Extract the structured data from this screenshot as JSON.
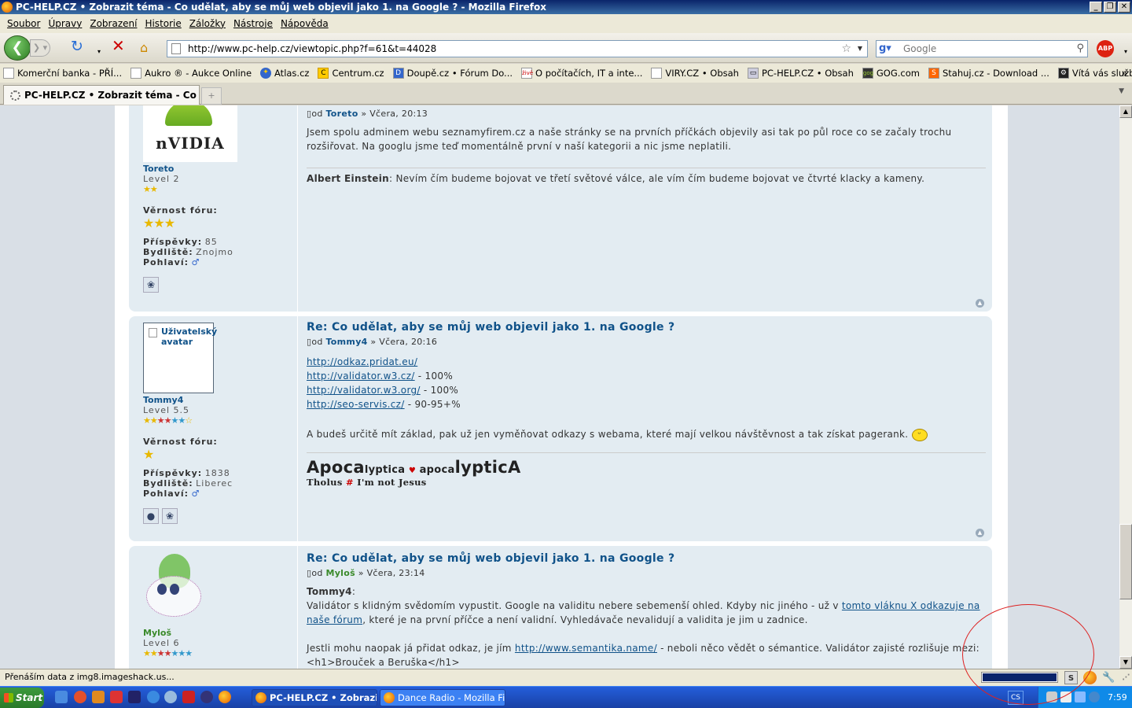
{
  "window": {
    "title": "PC-HELP.CZ • Zobrazit téma - Co udělat, aby se můj web objevil jako 1. na Google ? - Mozilla Firefox",
    "minimize": "0",
    "maximize": "1",
    "close": "r"
  },
  "menu": [
    "Soubor",
    "Úpravy",
    "Zobrazení",
    "Historie",
    "Záložky",
    "Nástroje",
    "Nápověda"
  ],
  "nav": {
    "url": "http://www.pc-help.cz/viewtopic.php?f=61&t=44028",
    "search_placeholder": "Google",
    "adblock_label": "ABP"
  },
  "bookmarks": [
    {
      "label": "Komerční banka - PŘÍ..."
    },
    {
      "label": "Aukro ® - Aukce Online"
    },
    {
      "label": "Atlas.cz"
    },
    {
      "label": "Centrum.cz"
    },
    {
      "label": "Doupě.cz • Fórum Do..."
    },
    {
      "label": "O počítačích, IT a inte..."
    },
    {
      "label": "VIRY.CZ • Obsah"
    },
    {
      "label": "PC-HELP.CZ • Obsah"
    },
    {
      "label": "GOG.com"
    },
    {
      "label": "Stahuj.cz - Download ..."
    },
    {
      "label": "Vítá vás služba Steam"
    }
  ],
  "tab": {
    "label": "PC-HELP.CZ • Zobrazit téma - Co udě..."
  },
  "posts": [
    {
      "avatar_text": "nVIDIA",
      "username": "Toreto",
      "level": "Level 2",
      "loyalty_label": "Věrnost fóru:",
      "posts_label": "Příspěvky:",
      "posts_value": "85",
      "home_label": "Bydliště:",
      "home_value": "Znojmo",
      "gender_label": "Pohlaví:",
      "meta_prefix": "od",
      "meta_author": "Toreto",
      "meta_date": "» Včera, 20:13",
      "text": "Jsem spolu adminem webu seznamyfirem.cz a naše stránky se na prvních příčkách objevily asi tak po půl roce co se začaly trochu rozšiřovat. Na googlu jsme teď momentálně první v naší kategorii a nic jsme neplatili.",
      "sig_author": "Albert Einstein",
      "sig_text": ": Nevím čím budeme bojovat ve třetí světové válce, ale vím čím budeme bojovat ve čtvrté klacky a kameny."
    },
    {
      "avatar_text": "Uživatelský avatar",
      "username": "Tommy4",
      "level": "Level 5.5",
      "loyalty_label": "Věrnost fóru:",
      "posts_label": "Příspěvky:",
      "posts_value": "1838",
      "home_label": "Bydliště:",
      "home_value": "Liberec",
      "gender_label": "Pohlaví:",
      "title": "Re: Co udělat, aby se můj web objevil jako 1. na Google ?",
      "meta_prefix": "od",
      "meta_author": "Tommy4",
      "meta_date": "» Včera, 20:16",
      "links": [
        {
          "url": "http://odkaz.pridat.eu/",
          "note": ""
        },
        {
          "url": "http://validator.w3.cz/",
          "note": " - 100%"
        },
        {
          "url": "http://validator.w3.org/",
          "note": " - 100%"
        },
        {
          "url": "http://seo-servis.cz/",
          "note": " - 90-95+%"
        }
      ],
      "text": "A budeš určitě mít základ, pak už jen vyměňovat odkazy s webama, které mají velkou návštěvnost a tak získat pagerank.",
      "sig_big1": "Apoca",
      "sig_small1": "lyptica",
      "sig_heart": "♥",
      "sig_small2": "apoca",
      "sig_big2": "lypticA",
      "sig_line2a": "Tholus",
      "sig_hash": "#",
      "sig_line2b": "I'm not Jesus"
    },
    {
      "username": "Myloš",
      "level": "Level 6",
      "title": "Re: Co udělat, aby se můj web objevil jako 1. na Google ?",
      "meta_prefix": "od",
      "meta_author": "Myloš",
      "meta_date": "» Včera, 23:14",
      "quote_author": "Tommy4",
      "text1a": "Validátor s klidným svědomím vypustit. Google na validitu nebere sebemenší ohled. Kdyby nic jiného - už v ",
      "text1_link": "tomto vláknu X odkazuje na naše fórum",
      "text1b": ", které je na první příčce a není validní. Vyhledávače nevalidují a validita je jim u zadnice.",
      "text2a": "Jestli mohu naopak já přidat odkaz, je jím ",
      "text2_link": "http://www.semantika.name/",
      "text2b": " - neboli něco vědět o sémantice. Validátor zajisté rozlišuje mezi:",
      "text3": "<h1>Brouček a Beruška</h1>"
    }
  ],
  "status": {
    "text": "Přenáším data z img8.imageshack.us..."
  },
  "taskbar": {
    "start": "Start",
    "tasks": [
      "PC-HELP.CZ • Zobrazit...",
      "Dance Radio - Mozilla Fir..."
    ],
    "lang": "CS",
    "clock": "7:59"
  }
}
